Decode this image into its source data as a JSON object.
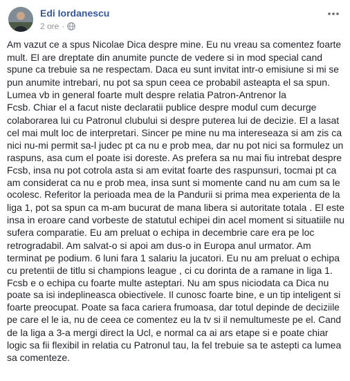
{
  "post": {
    "author": "Edi Iordanescu",
    "time": "2 ore",
    "separator": "·",
    "privacy_icon": "globe-icon",
    "more_icon": "more-horizontal-icon",
    "avatar_icon": "avatar-photo",
    "lines": [
      "Am vazut ce a spus Nicolae Dica despre mine. Eu nu vreau sa comentez foarte",
      "mult. El are dreptate din anumite puncte de vedere si in mod special cand",
      "spune ca trebuie sa ne respectam. Daca eu sunt invitat intr-o emisiune si mi se",
      "pun anumite intrebari, nu pot sa spun ceea ce probabil asteapta el sa spun.",
      "Lumea vb in general foarte mult despre relatia Patron-Antrenor la",
      "Fcsb. Chiar el a facut niste declaratii publice despre modul cum decurge",
      "colaborarea lui cu Patronul clubului si despre puterea lui de decizie. El a lasat",
      "cel mai mult loc de interpretari. Sincer pe mine nu ma intereseaza si am zis ca",
      "nici nu-mi permit sa-l judec pt ca nu e prob mea, dar nu pot nici sa formulez un",
      "raspuns, asa cum el poate isi doreste. As prefera sa nu mai fiu intrebat despre",
      "Fcsb, insa nu pot cotrola asta si am evitat foarte des raspunsuri, tocmai pt ca",
      "am considerat ca nu e prob mea, insa sunt si momente cand nu am cum sa le",
      "ocolesc. Referitor la perioada mea de la Pandurii si prima mea experienta de la",
      "liga 1, pot sa spun ca m-am bucurat de mana libera si autoritate totala . El este",
      "insa in eroare cand vorbeste de statutul echipei din acel moment si situatiile nu",
      "sufera comparatie. Eu am preluat o echipa in decembrie care era pe loc",
      "retrogradabil. Am salvat-o si apoi am dus-o in Europa anul urmator. Am",
      "terminat pe podium. 6 luni fara 1 salariu la jucatori. Eu nu am preluat o echipa",
      "cu pretentii de titlu si champions league , ci cu dorinta de a ramane in liga 1.",
      "Fcsb e o echipa cu foarte multe asteptari. Nu am spus niciodata ca Dica nu",
      "poate sa isi indeplineasca obiectivele. Il cunosc foarte bine, e un tip inteligent si",
      "foarte preocupat. Poate sa faca cariera frumoasa, dar totul depinde de deciziile",
      "pe care el le ia, nu de ceea ce comentez eu la tv si il nemultumeste pe el. Cand",
      "de la liga a 3-a mergi direct la Ucl, e normal ca ai ars etape si e poate chiar",
      "logic sa fii flexibil in relatia cu Patronul tau, la fel trebuie sa te astepti ca lumea",
      "sa comenteze."
    ]
  }
}
